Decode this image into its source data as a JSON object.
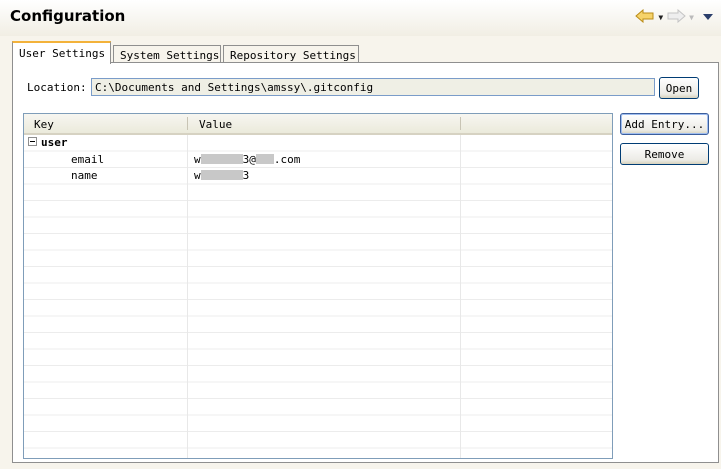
{
  "header": {
    "title": "Configuration"
  },
  "tabs": [
    {
      "label": "User Settings",
      "active": true
    },
    {
      "label": "System Settings",
      "active": false
    },
    {
      "label": "Repository Settings",
      "active": false
    }
  ],
  "location": {
    "label": "Location:",
    "value": "C:\\Documents and Settings\\amssy\\.gitconfig",
    "open_button": "Open"
  },
  "table": {
    "columns": [
      "Key",
      "Value"
    ],
    "section": "user",
    "entries": [
      {
        "key": "email",
        "value_prefix": "w",
        "value_mid": "3@",
        "value_suffix": ".com"
      },
      {
        "key": "name",
        "value_prefix": "w",
        "value_suffix": "3"
      }
    ]
  },
  "buttons": {
    "add_entry": "Add Entry...",
    "remove": "Remove"
  },
  "colors": {
    "active_tab_accent": "#f3b23a",
    "field_border": "#7a9cc9",
    "button_border": "#003c74"
  },
  "icons": [
    "back-arrow-icon",
    "forward-arrow-icon",
    "view-menu-icon",
    "collapse-icon"
  ]
}
